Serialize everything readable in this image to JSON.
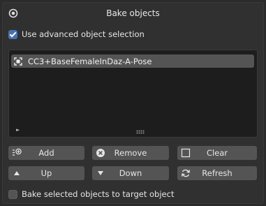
{
  "panel": {
    "title": "Bake objects",
    "header_icon": "circle-target-icon"
  },
  "options": {
    "advanced_selection": {
      "label": "Use advanced object selection",
      "checked": true
    },
    "bake_to_target": {
      "label": "Bake selected objects to target object",
      "checked": false
    }
  },
  "object_list": {
    "items": [
      {
        "label": "CC3+BaseFemaleInDaz-A-Pose",
        "icon": "object-box-icon",
        "selected": true
      }
    ],
    "expand_glyph": "►"
  },
  "buttons": {
    "add": {
      "label": "Add",
      "icon": "add-list-icon"
    },
    "remove": {
      "label": "Remove",
      "icon": "remove-x-icon"
    },
    "clear": {
      "label": "Clear",
      "icon": "clear-square-icon"
    },
    "up": {
      "label": "Up",
      "icon": "triangle-up-icon"
    },
    "down": {
      "label": "Down",
      "icon": "triangle-down-icon"
    },
    "refresh": {
      "label": "Refresh",
      "icon": "refresh-icon"
    }
  },
  "colors": {
    "accent": "#4772b3",
    "button": "#545454",
    "panel": "#303030",
    "list_bg": "#1d1d1d"
  }
}
